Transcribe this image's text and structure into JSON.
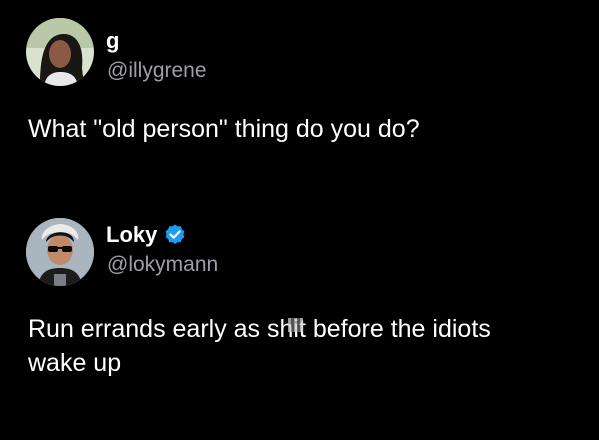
{
  "tweet1": {
    "author_name": "g",
    "author_handle": "@illygrene",
    "text": "What \"old person\" thing do you do?",
    "avatar_icon": "woman-portrait-avatar"
  },
  "tweet2": {
    "author_name": "Loky",
    "author_handle": "@lokymann",
    "text_part1": "Run errands early as s",
    "text_censored": "hi",
    "text_part2": "t before the idiots\nwake up",
    "avatar_icon": "man-sunglasses-portrait-avatar",
    "verified_icon": "verified-badge-icon",
    "verified_color": "#1d9bf0"
  },
  "colors": {
    "background": "#000000",
    "primary_text": "#ffffff",
    "secondary_text": "#9aa0a6"
  }
}
